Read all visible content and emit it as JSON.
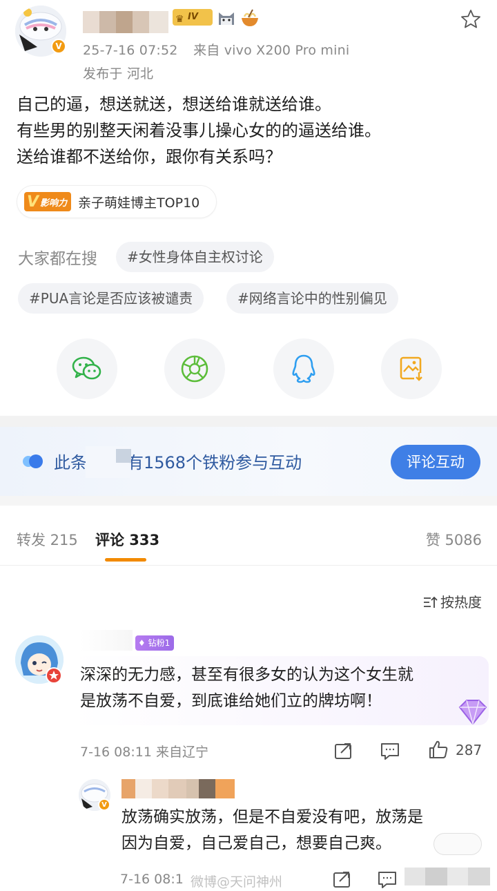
{
  "post": {
    "timestamp": "25-7-16 07:52",
    "source": "来自 vivo X200 Pro mini",
    "location": "发布于 河北",
    "level_badge": "IV",
    "body_lines": [
      "自己的逼，想送就送，想送给谁就送给谁。",
      "有些男的别整天闲着没事儿操心女的的逼送给谁。",
      "送给谁都不送给你，跟你有关系吗？"
    ],
    "influence_badge": "影响力",
    "influence_text": "亲子萌娃博主TOP10"
  },
  "searching": {
    "label": "大家都在搜",
    "tags": [
      "#女性身体自主权讨论",
      "#PUA言论是否应该被谴责",
      "#网络言论中的性别偏见"
    ]
  },
  "share_icons": [
    "wechat-icon",
    "moments-icon",
    "qq-icon",
    "save-image-icon"
  ],
  "banner": {
    "text": "此条微博有1568个铁粉参与互动",
    "text_prefix": "此条",
    "text_suffix": "有1568个铁粉参与互动",
    "button": "评论互动"
  },
  "tabs": {
    "repost": "转发 215",
    "comments": "评论 333",
    "likes": "赞 5086",
    "sort": "按热度"
  },
  "comments": [
    {
      "fan_badge": "钻粉1",
      "text_lines": [
        "深深的无力感，甚至有很多女的认为这个女生就",
        "是放荡不自爱，到底谁给她们立的牌坊啊！"
      ],
      "meta": "7-16 08:11 来自辽宁",
      "likes": "287"
    },
    {
      "text_lines": [
        "放荡确实放荡，但是不自爱没有吧，放荡是",
        "因为自爱，自己爱自己，想要自己爽。"
      ],
      "meta": "7-16 08:1",
      "watermark": "微博@天问神州"
    }
  ],
  "colors": {
    "accent": "#f28a00",
    "blue": "#3f7fe6",
    "badge_purple": "#a873ec"
  }
}
